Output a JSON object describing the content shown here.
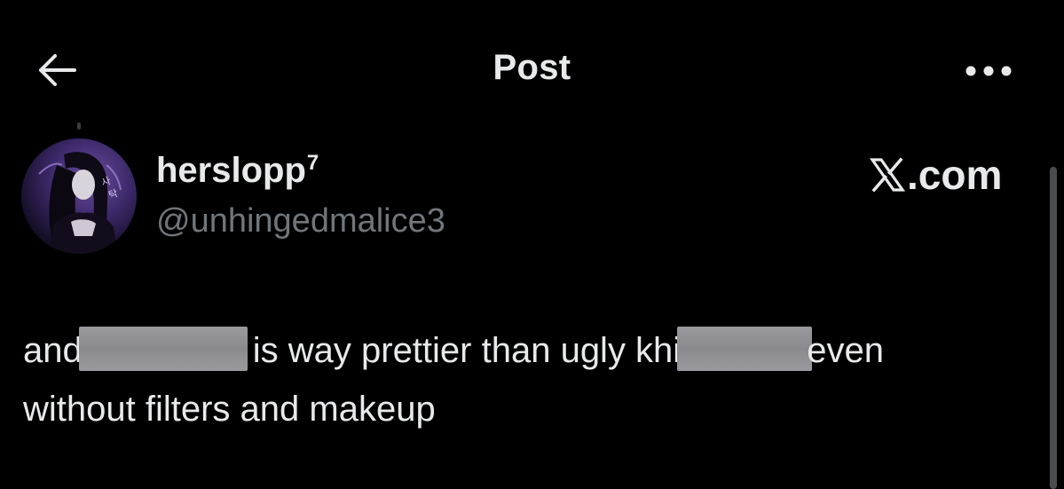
{
  "header": {
    "title": "Post",
    "back_icon": "arrow-left-icon",
    "more_icon": "more-horizontal-icon"
  },
  "post": {
    "author": {
      "display_name": "herslopp",
      "display_name_sup": "7",
      "handle": "@unhingedmalice3"
    },
    "source": {
      "text": ".com",
      "logo_icon": "x-logo-icon"
    },
    "text": {
      "part1": "and",
      "part2": "is way  prettier than ugly khi",
      "part3": "even",
      "line2": "without filters and makeup"
    }
  },
  "colors": {
    "background": "#000000",
    "primary_text": "#e7e9ea",
    "secondary_text": "#71767b",
    "redaction": "#8e8e92"
  }
}
